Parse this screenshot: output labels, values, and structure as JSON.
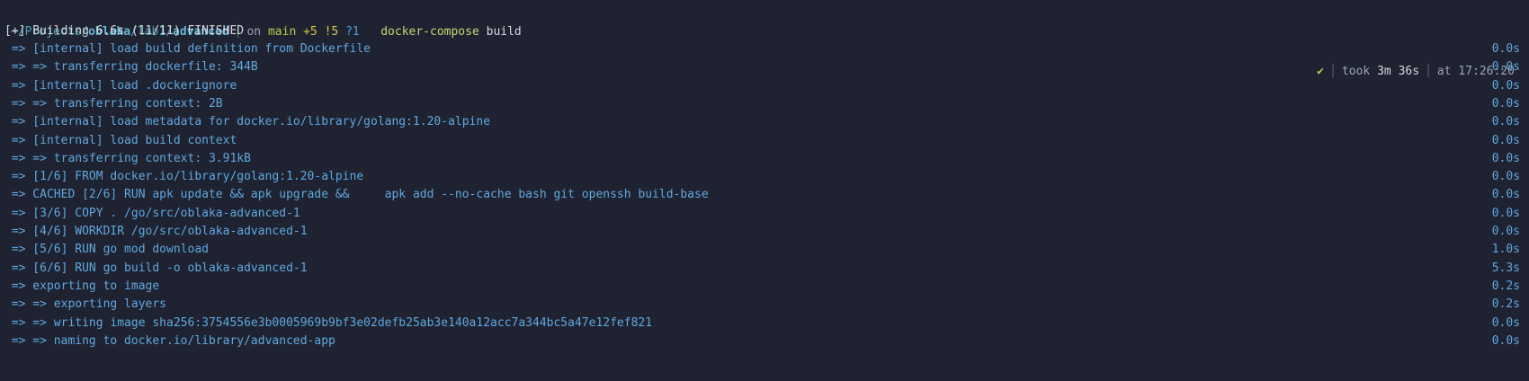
{
  "prompt": {
    "path_prefix": "~/Projects/",
    "path_seg1": "oblaka",
    "path_sep1": "/",
    "path_seg2": "lab1",
    "path_sep2": "/",
    "path_seg3": "advanced",
    "vcs_on": "on",
    "branch": "main",
    "staged": "+5",
    "modified": "!5",
    "untracked": "?1",
    "command": "docker-compose",
    "command_arg": "build",
    "status_icon": "✔",
    "took_label": "took",
    "took_value": "3m 36s",
    "at_label": "at",
    "time": "17:26:20"
  },
  "build_header": "[+] Building 6.6s (11/11) FINISHED",
  "steps": [
    {
      "text": " => [internal] load build definition from Dockerfile",
      "time": "0.0s"
    },
    {
      "text": " => => transferring dockerfile: 344B",
      "time": "0.0s"
    },
    {
      "text": " => [internal] load .dockerignore",
      "time": "0.0s"
    },
    {
      "text": " => => transferring context: 2B",
      "time": "0.0s"
    },
    {
      "text": " => [internal] load metadata for docker.io/library/golang:1.20-alpine",
      "time": "0.0s"
    },
    {
      "text": " => [internal] load build context",
      "time": "0.0s"
    },
    {
      "text": " => => transferring context: 3.91kB",
      "time": "0.0s"
    },
    {
      "text": " => [1/6] FROM docker.io/library/golang:1.20-alpine",
      "time": "0.0s"
    },
    {
      "text": " => CACHED [2/6] RUN apk update && apk upgrade &&     apk add --no-cache bash git openssh build-base",
      "time": "0.0s"
    },
    {
      "text": " => [3/6] COPY . /go/src/oblaka-advanced-1",
      "time": "0.0s"
    },
    {
      "text": " => [4/6] WORKDIR /go/src/oblaka-advanced-1",
      "time": "0.0s"
    },
    {
      "text": " => [5/6] RUN go mod download",
      "time": "1.0s"
    },
    {
      "text": " => [6/6] RUN go build -o oblaka-advanced-1",
      "time": "5.3s"
    },
    {
      "text": " => exporting to image",
      "time": "0.2s"
    },
    {
      "text": " => => exporting layers",
      "time": "0.2s"
    },
    {
      "text": " => => writing image sha256:3754556e3b0005969b9bf3e02defb25ab3e140a12acc7a344bc5a47e12fef821",
      "time": "0.0s"
    },
    {
      "text": " => => naming to docker.io/library/advanced-app",
      "time": "0.0s"
    }
  ]
}
